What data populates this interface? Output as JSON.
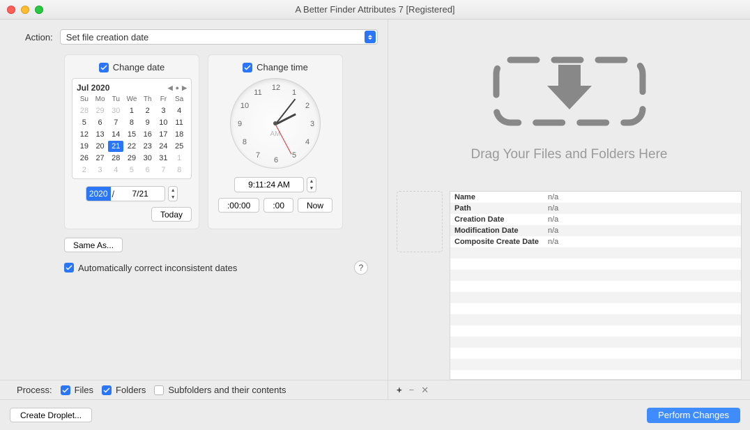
{
  "window": {
    "title": "A Better Finder Attributes 7 [Registered]"
  },
  "action": {
    "label": "Action:",
    "value": "Set file creation date"
  },
  "date_panel": {
    "checkbox_label": "Change date",
    "month_year": "Jul 2020",
    "dow": [
      "Su",
      "Mo",
      "Tu",
      "We",
      "Th",
      "Fr",
      "Sa"
    ],
    "weeks": [
      [
        {
          "d": "28",
          "dim": true
        },
        {
          "d": "29",
          "dim": true
        },
        {
          "d": "30",
          "dim": true
        },
        {
          "d": "1"
        },
        {
          "d": "2"
        },
        {
          "d": "3"
        },
        {
          "d": "4"
        }
      ],
      [
        {
          "d": "5"
        },
        {
          "d": "6"
        },
        {
          "d": "7"
        },
        {
          "d": "8"
        },
        {
          "d": "9"
        },
        {
          "d": "10"
        },
        {
          "d": "11"
        }
      ],
      [
        {
          "d": "12"
        },
        {
          "d": "13"
        },
        {
          "d": "14"
        },
        {
          "d": "15"
        },
        {
          "d": "16"
        },
        {
          "d": "17"
        },
        {
          "d": "18"
        }
      ],
      [
        {
          "d": "19"
        },
        {
          "d": "20"
        },
        {
          "d": "21",
          "sel": true
        },
        {
          "d": "22"
        },
        {
          "d": "23"
        },
        {
          "d": "24"
        },
        {
          "d": "25"
        }
      ],
      [
        {
          "d": "26"
        },
        {
          "d": "27"
        },
        {
          "d": "28"
        },
        {
          "d": "29"
        },
        {
          "d": "30"
        },
        {
          "d": "31"
        },
        {
          "d": "1",
          "dim": true
        }
      ],
      [
        {
          "d": "2",
          "dim": true
        },
        {
          "d": "3",
          "dim": true
        },
        {
          "d": "4",
          "dim": true
        },
        {
          "d": "5",
          "dim": true
        },
        {
          "d": "6",
          "dim": true
        },
        {
          "d": "7",
          "dim": true
        },
        {
          "d": "8",
          "dim": true
        }
      ]
    ],
    "year_value": "2020",
    "date_value": "7/21",
    "today_label": "Today"
  },
  "time_panel": {
    "checkbox_label": "Change time",
    "ampm": "AM",
    "time_value": "9:11:24 AM",
    "btn_zero_sec": ":00:00",
    "btn_zero": ":00",
    "btn_now": "Now"
  },
  "same_as": {
    "label": "Same As..."
  },
  "auto": {
    "label": "Automatically correct inconsistent dates"
  },
  "help": {
    "label": "?"
  },
  "dropzone": {
    "text": "Drag Your Files and Folders Here"
  },
  "info": {
    "rows": [
      {
        "k": "Name",
        "v": "n/a"
      },
      {
        "k": "Path",
        "v": "n/a"
      },
      {
        "k": "Creation Date",
        "v": "n/a"
      },
      {
        "k": "Modification Date",
        "v": "n/a"
      },
      {
        "k": "Composite Create Date",
        "v": "n/a"
      }
    ]
  },
  "process": {
    "label": "Process:",
    "files": "Files",
    "folders": "Folders",
    "subfolders": "Subfolders and their contents"
  },
  "footer": {
    "droplet": "Create Droplet...",
    "perform": "Perform Changes"
  },
  "clock_numbers": [
    "12",
    "1",
    "2",
    "3",
    "4",
    "5",
    "6",
    "7",
    "8",
    "9",
    "10",
    "11"
  ]
}
